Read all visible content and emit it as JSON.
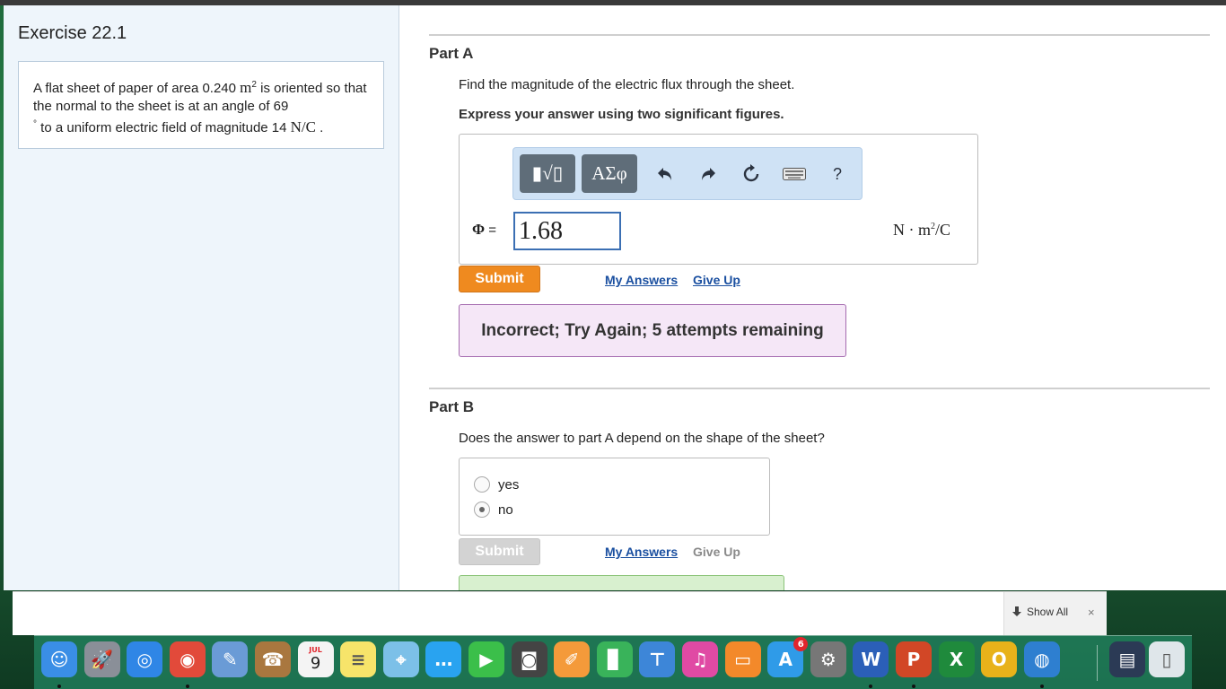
{
  "exercise": {
    "title": "Exercise 22.1",
    "problem": {
      "p1": "A flat sheet of paper of area 0.240 ",
      "area_unit": "m",
      "area_exp": "2",
      "p2": " is oriented so that the normal to the sheet is at an angle of 69",
      "degree": "°",
      "p3": " to a uniform electric field of magnitude 14 ",
      "field_unit": "N/C",
      "p4": " ."
    }
  },
  "part_a": {
    "title": "Part A",
    "question": "Find the magnitude of the electric flux through the sheet.",
    "instruction": "Express your answer using two significant figures.",
    "toolbar": {
      "templates": "▮√▯",
      "greek": "ΑΣφ",
      "undo": "↶",
      "redo": "↷",
      "reset": "↻",
      "keyboard": "⌨",
      "help": "?"
    },
    "variable": "Φ",
    "equals": " =",
    "answer_value": "1.68",
    "units_n": "N · m",
    "units_exp": "2",
    "units_den": "/C",
    "submit": "Submit",
    "my_answers": "My Answers",
    "give_up": "Give Up",
    "feedback": "Incorrect; Try Again; 5 attempts remaining"
  },
  "part_b": {
    "title": "Part B",
    "question": "Does the answer to part A depend on the shape of the sheet?",
    "options": [
      {
        "label": "yes",
        "selected": false
      },
      {
        "label": "no",
        "selected": true
      }
    ],
    "submit": "Submit",
    "my_answers": "My Answers",
    "give_up": "Give Up"
  },
  "download_bar": {
    "show_all": "Show All",
    "close": "×"
  },
  "dock": {
    "calendar_month": "JUL",
    "calendar_day": "9",
    "appstore_badge": "6",
    "items": [
      {
        "name": "finder-icon",
        "glyph": "☺",
        "color": "#3a8ee6"
      },
      {
        "name": "launchpad-icon",
        "glyph": "🚀",
        "color": "#8a8f98"
      },
      {
        "name": "safari-icon",
        "glyph": "◎",
        "color": "#2f86e6"
      },
      {
        "name": "chrome-icon",
        "glyph": "◉",
        "color": "#e24a3a"
      },
      {
        "name": "preview-icon",
        "glyph": "✎",
        "color": "#6a9bd6"
      },
      {
        "name": "contacts-icon",
        "glyph": "☎",
        "color": "#a9773f"
      },
      {
        "name": "calendar-icon",
        "glyph": "",
        "color": "#f4f4f4"
      },
      {
        "name": "notes-icon",
        "glyph": "≡",
        "color": "#f7e46a"
      },
      {
        "name": "maps-icon",
        "glyph": "⌖",
        "color": "#7cc0e8"
      },
      {
        "name": "messages-icon",
        "glyph": "…",
        "color": "#29a3f0"
      },
      {
        "name": "facetime-icon",
        "glyph": "▶",
        "color": "#3bbf4a"
      },
      {
        "name": "photo-booth-icon",
        "glyph": "◙",
        "color": "#444"
      },
      {
        "name": "pages-icon",
        "glyph": "✐",
        "color": "#f49a3a"
      },
      {
        "name": "numbers-icon",
        "glyph": "▊",
        "color": "#39b35a"
      },
      {
        "name": "keynote-icon",
        "glyph": "⊤",
        "color": "#3d86d8"
      },
      {
        "name": "itunes-icon",
        "glyph": "♫",
        "color": "#e04aa4"
      },
      {
        "name": "ibooks-icon",
        "glyph": "▭",
        "color": "#f3892a"
      },
      {
        "name": "app-store-icon",
        "glyph": "A",
        "color": "#2f9be8"
      },
      {
        "name": "system-preferences-icon",
        "glyph": "⚙",
        "color": "#777"
      },
      {
        "name": "word-icon",
        "glyph": "W",
        "color": "#2b5fb8"
      },
      {
        "name": "powerpoint-icon",
        "glyph": "P",
        "color": "#d24726"
      },
      {
        "name": "excel-icon",
        "glyph": "X",
        "color": "#1f8a3c"
      },
      {
        "name": "outlook-icon",
        "glyph": "O",
        "color": "#e8b21a"
      },
      {
        "name": "network-globe-icon",
        "glyph": "◍",
        "color": "#2e7fd0"
      },
      {
        "name": "documents-folder-icon",
        "glyph": "▤",
        "color": "#2b3a55"
      },
      {
        "name": "trash-icon",
        "glyph": "▯",
        "color": "#dfe6ea"
      }
    ]
  },
  "colors": {
    "accent_blue": "#3b6fb3",
    "link_blue": "#1a4fa0",
    "submit_orange": "#ef8a1f",
    "submit_disabled": "#cfcfcf",
    "feedback_purple": "#a56cb0"
  }
}
